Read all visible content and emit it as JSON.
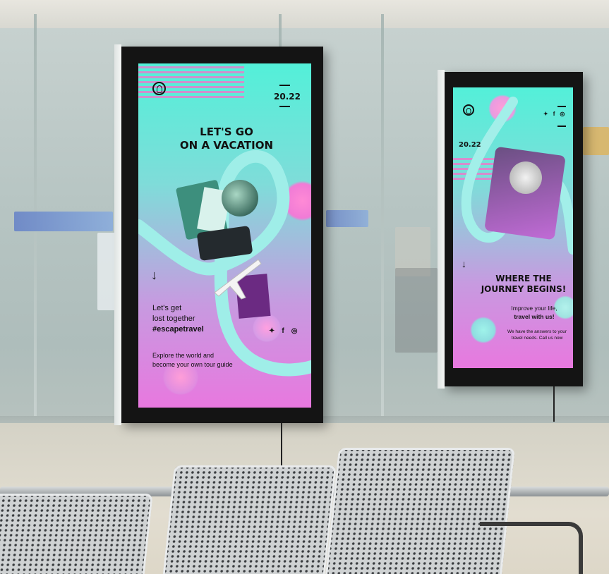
{
  "scene": {
    "description_colors": {
      "poster_top": "#53f0d9",
      "poster_bottom": "#e878df",
      "accent_pink": "#ff69c8",
      "frame": "#141414"
    }
  },
  "poster_left": {
    "year": "20.22",
    "headline_line1": "LET'S GO",
    "headline_line2": "ON A VACATION",
    "tagline_line1": "Let's get",
    "tagline_line2": "lost together",
    "hashtag": "#escapetravel",
    "body_line1": "Explore the world and",
    "body_line2": "become your own tour guide",
    "arrow_icon": "↓",
    "social_icons": [
      "twitter-icon",
      "facebook-icon",
      "instagram-icon"
    ]
  },
  "poster_right": {
    "year": "20.22",
    "headline_line1": "WHERE THE",
    "headline_line2": "JOURNEY BEGINS!",
    "sub_line1": "Improve your life,",
    "sub_line2": "travel with us!",
    "body_line1": "We have the answers to your",
    "body_line2": "travel needs. Call us now",
    "arrow_icon": "↓",
    "social_icons": [
      "twitter-icon",
      "facebook-icon",
      "instagram-icon"
    ]
  }
}
